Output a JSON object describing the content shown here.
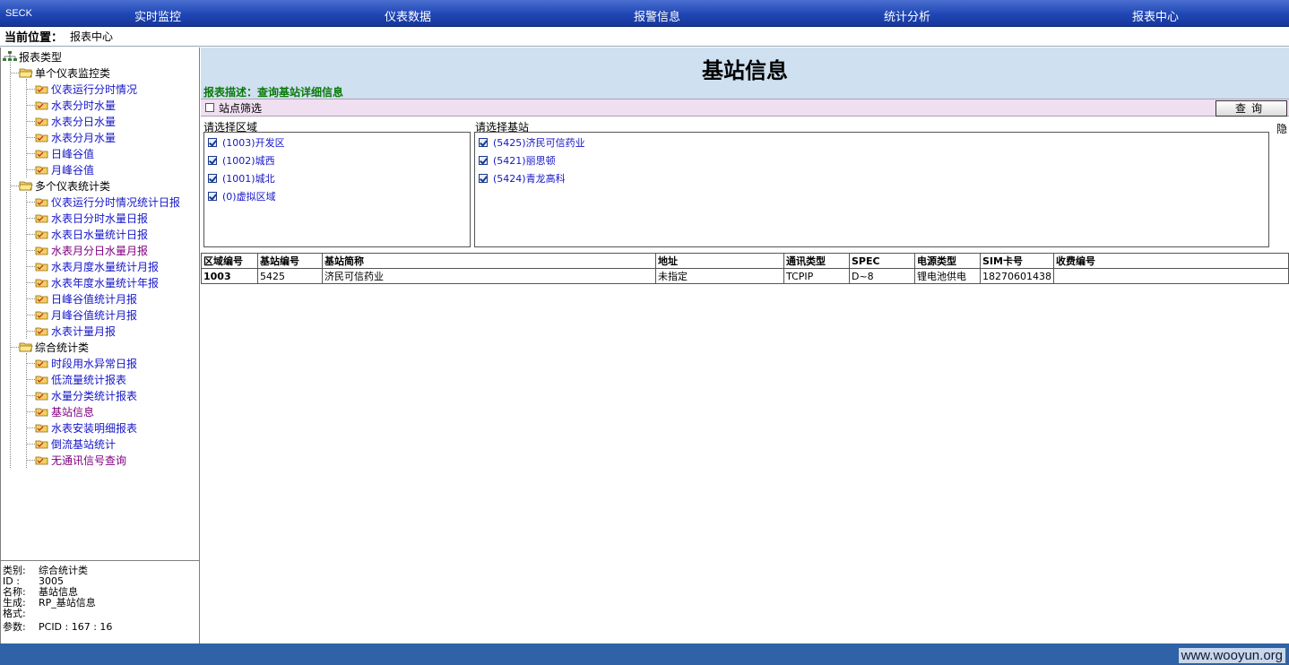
{
  "topnav": {
    "brand": "SECK",
    "items": [
      {
        "label": "实时监控"
      },
      {
        "label": "仪表数据"
      },
      {
        "label": "报警信息"
      },
      {
        "label": "统计分析"
      },
      {
        "label": "报表中心"
      }
    ]
  },
  "location": {
    "label": "当前位置：",
    "value": "报表中心"
  },
  "tree": {
    "root": "报表类型",
    "groups": [
      {
        "label": "单个仪表监控类",
        "items": [
          "仪表运行分时情况",
          "水表分时水量",
          "水表分日水量",
          "水表分月水量",
          "日峰谷值",
          "月峰谷值"
        ]
      },
      {
        "label": "多个仪表统计类",
        "items": [
          "仪表运行分时情况统计日报",
          "水表日分时水量日报",
          "水表日水量统计日报",
          "水表月分日水量月报",
          "水表月度水量统计月报",
          "水表年度水量统计年报",
          "日峰谷值统计月报",
          "月峰谷值统计月报",
          "水表计量月报"
        ]
      },
      {
        "label": "综合统计类",
        "items": [
          "时段用水异常日报",
          "低流量统计报表",
          "水量分类统计报表",
          "基站信息",
          "水表安装明细报表",
          "倒流基站统计",
          "无通讯信号查询"
        ]
      }
    ]
  },
  "info": {
    "category_k": "类别:",
    "category_v": "综合统计类",
    "id_k": "ID :",
    "id_v": "3005",
    "name_k": "名称:",
    "name_v": "基站信息",
    "gen_k": "生成:",
    "gen_v": "RP_基站信息",
    "format_k": "格式:",
    "format_v": "",
    "param_k": "参数:",
    "param_v": "PCID : 167 : 16"
  },
  "report": {
    "title": "基站信息",
    "desc": "报表描述：查询基站详细信息",
    "filter_label": "站点筛选",
    "query_button": "查询",
    "hide_label": "隐",
    "region_label": "请选择区域",
    "regions": [
      "(1003)开发区",
      "(1002)城西",
      "(1001)城北",
      "(0)虚拟区域"
    ],
    "station_label": "请选择基站",
    "stations": [
      "(5425)济民可信药业",
      "(5421)丽思顿",
      "(5424)青龙高科"
    ]
  },
  "table": {
    "columns": [
      "区域编号",
      "基站编号",
      "基站简称",
      "地址",
      "通讯类型",
      "SPEC",
      "电源类型",
      "SIM卡号",
      "收费编号"
    ],
    "rows": [
      [
        "1003",
        "5425",
        "济民可信药业",
        "未指定",
        "TCPIP",
        "D~8",
        "锂电池供电",
        "18270601438",
        ""
      ]
    ]
  },
  "watermark": "www.wooyun.org",
  "colors": {
    "nav": "#1f46b4",
    "header_bg": "#cfe0f0",
    "filter_bg": "#f0dff0",
    "link": "#1515c8",
    "visited": "#800080",
    "desc": "#0a7a0a",
    "status": "#2f62a6"
  }
}
